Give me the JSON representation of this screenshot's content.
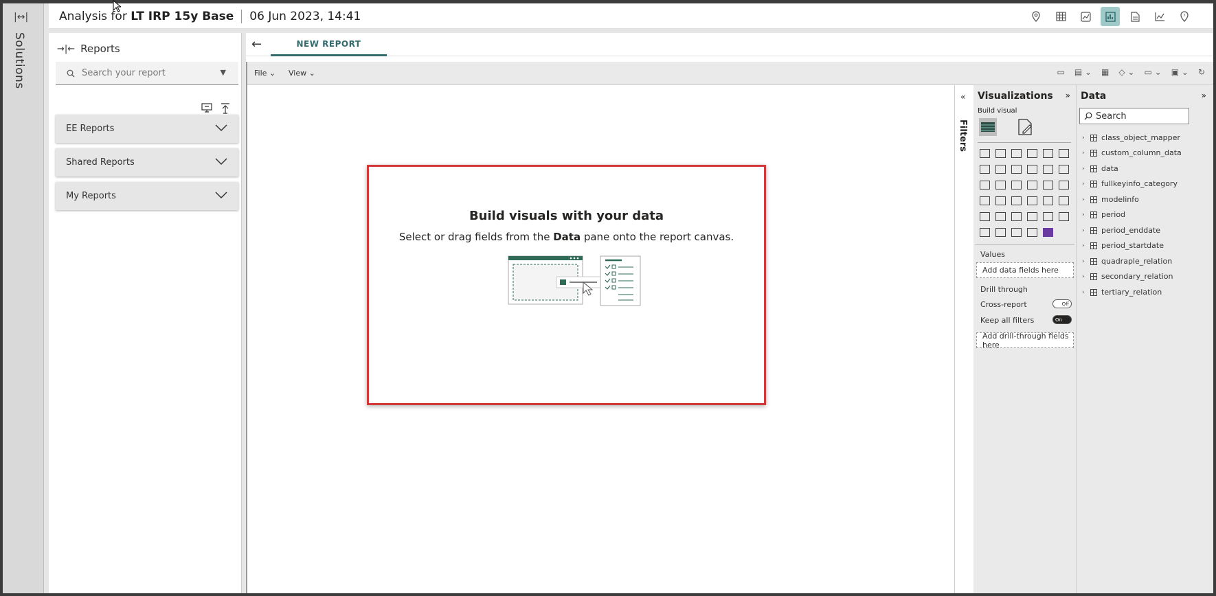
{
  "rail": {
    "label": "Solutions"
  },
  "header": {
    "title_prefix": "Analysis for ",
    "title_bold": "LT IRP 15y Base",
    "timestamp": "06 Jun 2023, 14:41"
  },
  "reports": {
    "title": "Reports",
    "search_placeholder": "Search your report",
    "sections": [
      {
        "label": "EE Reports"
      },
      {
        "label": "Shared Reports"
      },
      {
        "label": "My Reports"
      }
    ]
  },
  "tabs": {
    "active": "NEW REPORT"
  },
  "toolbar": {
    "file": "File",
    "view": "View"
  },
  "canvas": {
    "title": "Build visuals with your data",
    "sub_prefix": "Select or drag fields from the ",
    "sub_bold": "Data",
    "sub_suffix": " pane onto the report canvas."
  },
  "filters": {
    "label": "Filters"
  },
  "visualizations": {
    "title": "Visualizations",
    "build_visual": "Build visual",
    "values_label": "Values",
    "values_drop": "Add data fields here",
    "drill_label": "Drill through",
    "cross_report": "Cross-report",
    "cross_report_state": "Off",
    "keep_filters": "Keep all filters",
    "keep_filters_state": "On",
    "drill_drop": "Add drill-through fields here"
  },
  "data": {
    "title": "Data",
    "search": "Search",
    "tables": [
      "class_object_mapper",
      "custom_column_data",
      "data",
      "fullkeyinfo_category",
      "modelinfo",
      "period",
      "period_enddate",
      "period_startdate",
      "quadraple_relation",
      "secondary_relation",
      "tertiary_relation"
    ]
  }
}
